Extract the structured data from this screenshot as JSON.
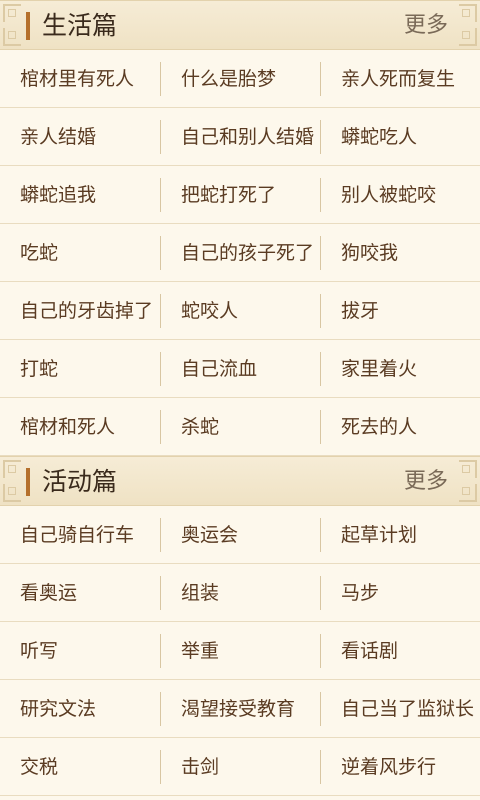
{
  "sections": [
    {
      "title": "生活篇",
      "more_label": "更多",
      "rows": [
        [
          "棺材里有死人",
          "什么是胎梦",
          "亲人死而复生"
        ],
        [
          "亲人结婚",
          "自己和别人结婚",
          "蟒蛇吃人"
        ],
        [
          "蟒蛇追我",
          "把蛇打死了",
          "别人被蛇咬"
        ],
        [
          "吃蛇",
          "自己的孩子死了",
          "狗咬我"
        ],
        [
          "自己的牙齿掉了",
          "蛇咬人",
          "拔牙"
        ],
        [
          "打蛇",
          "自己流血",
          "家里着火"
        ],
        [
          "棺材和死人",
          "杀蛇",
          "死去的人"
        ]
      ]
    },
    {
      "title": "活动篇",
      "more_label": "更多",
      "rows": [
        [
          "自己骑自行车",
          "奥运会",
          "起草计划"
        ],
        [
          "看奥运",
          "组装",
          "马步"
        ],
        [
          "听写",
          "举重",
          "看话剧"
        ],
        [
          "研究文法",
          "渴望接受教育",
          "自己当了监狱长"
        ],
        [
          "交税",
          "击剑",
          "逆着风步行"
        ]
      ]
    }
  ],
  "colors": {
    "accent": "#b5702c",
    "background": "#fdf8ec",
    "header_background": "#f3e7cd"
  }
}
